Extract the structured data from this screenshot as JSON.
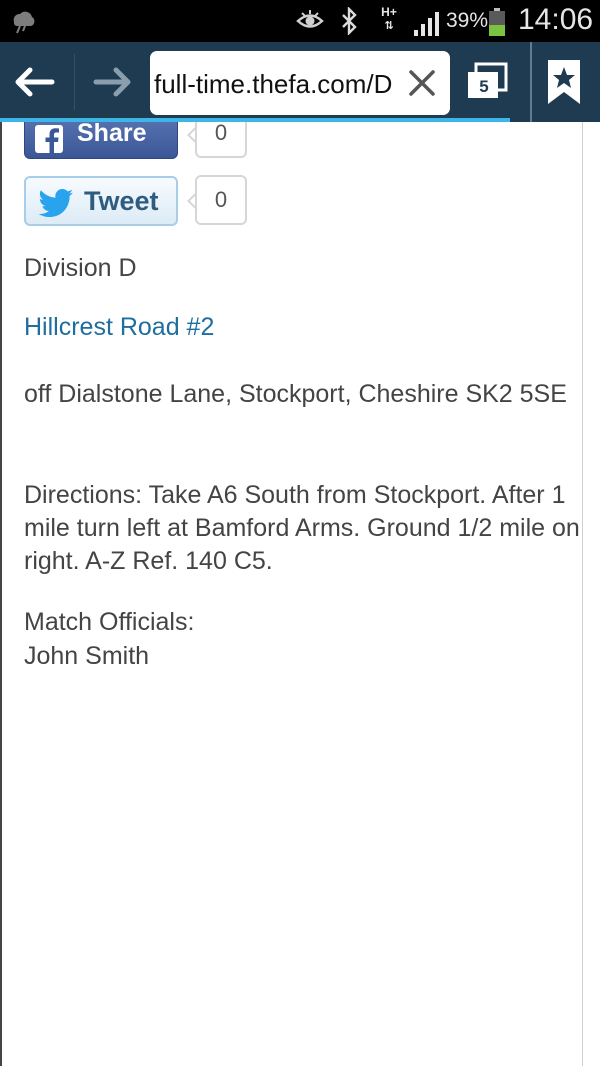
{
  "status_bar": {
    "battery_percent": "39%",
    "network": "H+",
    "time": "14:06"
  },
  "browser": {
    "url": "full-time.thefa.com/D",
    "tab_count": "5",
    "load_progress": 0.85
  },
  "social": {
    "share_label": "Share",
    "share_count": "0",
    "tweet_label": "Tweet",
    "tweet_count": "0"
  },
  "venue": {
    "division": "Division D",
    "ground_name": "Hillcrest Road #2",
    "address": "off Dialstone Lane, Stockport, Cheshire SK2 5SE",
    "directions": "Directions:  Take A6 South from Stockport. After 1 mile turn left at Bamford Arms. Ground 1/2 mile on right. A-Z Ref. 140 C5.",
    "officials_heading": "Match Officials:",
    "official_name": "John Smith"
  },
  "icons": [
    "weather-icon",
    "eye-icon",
    "bluetooth-icon",
    "signal-icon",
    "battery-icon",
    "back-arrow-icon",
    "forward-arrow-icon",
    "clear-icon",
    "tabs-icon",
    "bookmark-star-icon",
    "facebook-icon",
    "twitter-icon"
  ]
}
